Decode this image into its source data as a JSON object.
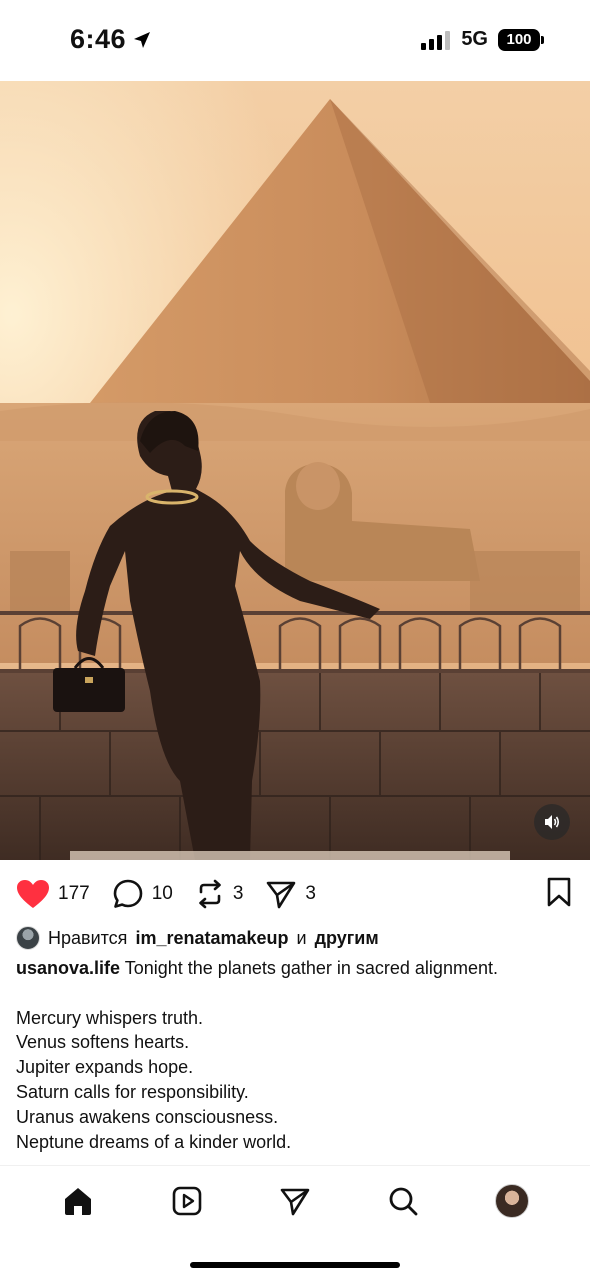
{
  "status_bar": {
    "time": "6:46",
    "network": "5G",
    "battery": "100"
  },
  "media": {
    "icon": "sound-icon"
  },
  "actions": {
    "likes": "177",
    "comments": "10",
    "reposts": "3",
    "shares": "3",
    "liked": true,
    "like_color": "#ff3040"
  },
  "likes_line": {
    "prefix": "Нравится",
    "user": "im_renatamakeup",
    "connector": "и",
    "others": "другим"
  },
  "caption": {
    "username": "usanova.life",
    "first_line": "Tonight the planets gather in sacred alignment.",
    "lines": [
      "Mercury whispers truth.",
      "Venus softens hearts.",
      "Jupiter expands hope.",
      "Saturn calls for responsibility.",
      "Uranus awakens consciousness.",
      "Neptune dreams of a kinder world."
    ]
  },
  "bottom_nav": {
    "items": [
      "home-icon",
      "reels-icon",
      "direct-icon",
      "search-icon",
      "profile-avatar"
    ]
  }
}
